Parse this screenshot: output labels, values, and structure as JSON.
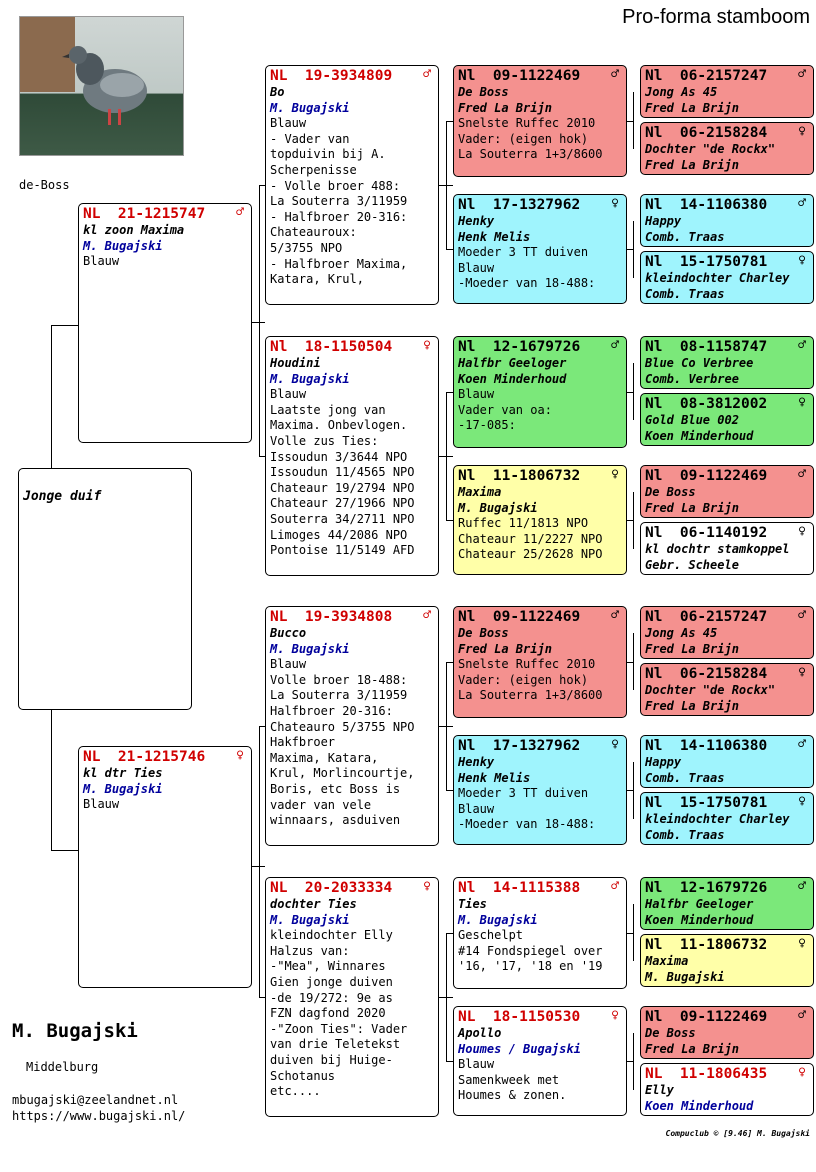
{
  "title": "Pro-forma stamboom",
  "photo_caption": "de-Boss",
  "young_bird_label": "Jonge duif",
  "owner": {
    "name": "M. Bugajski",
    "city": "Middelburg",
    "email": "mbugajski@zeelandnet.nl",
    "website": "https://www.bugajski.nl/"
  },
  "footer": "Compuclub © [9.46]  M. Bugajski",
  "sex_icons": {
    "male": "♂",
    "female": "♀"
  },
  "gen1": [
    {
      "ring": "NL  21-1215747",
      "sex": "♂",
      "name": "kl zoon Maxima",
      "owner": "M. Bugajski",
      "note": "Blauw"
    },
    {
      "ring": "NL  21-1215746",
      "sex": "♀",
      "name": "kl dtr Ties",
      "owner": "M. Bugajski",
      "note": "Blauw"
    }
  ],
  "gen2": [
    {
      "ring": "NL  19-3934809",
      "sex": "♂",
      "name": "Bo",
      "owner": "M. Bugajski",
      "note": "Blauw\n- Vader van\ntopduivin bij A.\nScherpenisse\n- Volle broer 488:\nLa Souterra  3/11959\n- Halfbroer 20-316:\nChateauroux:\n        5/3755 NPO\n- Halfbroer Maxima,\nKatara, Krul,"
    },
    {
      "ring": "Nl  18-1150504",
      "sex": "♀",
      "name": "Houdini",
      "owner": "M. Bugajski",
      "note": "Blauw\nLaatste jong van\nMaxima. Onbevlogen.\nVolle zus Ties:\nIssoudun 3/3644 NPO\nIssoudun 11/4565 NPO\nChateaur 19/2794 NPO\nChateaur 27/1966 NPO\nSouterra 34/2711 NPO\nLimoges 44/2086 NPO\nPontoise 11/5149 AFD"
    },
    {
      "ring": "NL  19-3934808",
      "sex": "♂",
      "name": "Bucco",
      "owner": "M. Bugajski",
      "note": "Blauw\nVolle broer 18-488:\nLa Souterra  3/11959\nHalfbroer 20-316:\nChateauro 5/3755 NPO\nHakfbroer\nMaxima, Katara,\nKrul, Morlincourtje,\nBoris, etc Boss is\nvader van vele\nwinnaars, asduiven"
    },
    {
      "ring": "NL  20-2033334",
      "sex": "♀",
      "name": "dochter Ties",
      "owner": "M. Bugajski",
      "note": "kleindochter Elly\nHalzus van:\n-\"Mea\", Winnares\nGien jonge duiven\n-de 19/272: 9e as\nFZN dagfond 2020\n-\"Zoon Ties\": Vader\nvan drie Teletekst\nduiven bij Huige-\nSchotanus\netc...."
    }
  ],
  "gen3": [
    {
      "ring": "Nl  09-1122469",
      "sex": "♂",
      "name": "De Boss",
      "owner": "Fred La Brijn",
      "note": "Snelste Ruffec 2010\nVader: (eigen hok)\nLa Souterra 1+3/8600",
      "color": "red"
    },
    {
      "ring": "Nl  17-1327962",
      "sex": "♀",
      "name": "Henky",
      "owner": "Henk Melis",
      "note": "Moeder 3 TT duiven\nBlauw\n-Moeder van 18-488:",
      "color": "cyan"
    },
    {
      "ring": "Nl  12-1679726",
      "sex": "♂",
      "name": "Halfbr Geeloger",
      "owner": "Koen Minderhoud",
      "note": "Blauw\nVader van oa:\n-17-085:",
      "color": "green"
    },
    {
      "ring": "Nl  11-1806732",
      "sex": "♀",
      "name": "Maxima",
      "owner": "M. Bugajski",
      "note": "Ruffec 11/1813 NPO\nChateaur 11/2227 NPO\nChateaur 25/2628 NPO",
      "color": "yellow"
    },
    {
      "ring": "Nl  09-1122469",
      "sex": "♂",
      "name": "De Boss",
      "owner": "Fred La Brijn",
      "note": "Snelste Ruffec 2010\nVader: (eigen hok)\nLa Souterra 1+3/8600",
      "color": "red"
    },
    {
      "ring": "Nl  17-1327962",
      "sex": "♀",
      "name": "Henky",
      "owner": "Henk Melis",
      "note": "Moeder 3 TT duiven\nBlauw\n-Moeder van 18-488:",
      "color": "cyan"
    },
    {
      "ring": "Nl  14-1115388",
      "sex": "♂",
      "name": "Ties",
      "owner": "M. Bugajski",
      "note": "Geschelpt\n#14 Fondspiegel over\n'16, '17, '18 en '19",
      "color": "white"
    },
    {
      "ring": "NL  18-1150530",
      "sex": "♀",
      "name": "Apollo",
      "owner": "Houmes / Bugajski",
      "note": "Blauw\nSamenkweek met\nHoumes & zonen.",
      "color": "white"
    }
  ],
  "gen4": [
    {
      "ring": "Nl  06-2157247",
      "sex": "♂",
      "name": "Jong As 45",
      "owner": "Fred La Brijn",
      "color": "red"
    },
    {
      "ring": "Nl  06-2158284",
      "sex": "♀",
      "name": "Dochter \"de Rockx\"",
      "owner": "Fred La Brijn",
      "color": "red"
    },
    {
      "ring": "Nl  14-1106380",
      "sex": "♂",
      "name": "Happy",
      "owner": "Comb. Traas",
      "color": "cyan"
    },
    {
      "ring": "Nl  15-1750781",
      "sex": "♀",
      "name": "kleindochter Charley",
      "owner": "Comb. Traas",
      "color": "cyan"
    },
    {
      "ring": "Nl  08-1158747",
      "sex": "♂",
      "name": "Blue Co Verbree",
      "owner": "Comb. Verbree",
      "color": "green"
    },
    {
      "ring": "Nl  08-3812002",
      "sex": "♀",
      "name": "Gold Blue 002",
      "owner": "Koen Minderhoud",
      "color": "green"
    },
    {
      "ring": "Nl  09-1122469",
      "sex": "♂",
      "name": "De Boss",
      "owner": "Fred La Brijn",
      "color": "red"
    },
    {
      "ring": "Nl  06-1140192",
      "sex": "♀",
      "name": "kl dochtr stamkoppel",
      "owner": "Gebr. Scheele",
      "color": "white"
    },
    {
      "ring": "Nl  06-2157247",
      "sex": "♂",
      "name": "Jong As 45",
      "owner": "Fred La Brijn",
      "color": "red"
    },
    {
      "ring": "Nl  06-2158284",
      "sex": "♀",
      "name": "Dochter \"de Rockx\"",
      "owner": "Fred La Brijn",
      "color": "red"
    },
    {
      "ring": "Nl  14-1106380",
      "sex": "♂",
      "name": "Happy",
      "owner": "Comb. Traas",
      "color": "cyan"
    },
    {
      "ring": "Nl  15-1750781",
      "sex": "♀",
      "name": "kleindochter Charley",
      "owner": "Comb. Traas",
      "color": "cyan"
    },
    {
      "ring": "Nl  12-1679726",
      "sex": "♂",
      "name": "Halfbr Geeloger",
      "owner": "Koen Minderhoud",
      "color": "green"
    },
    {
      "ring": "Nl  11-1806732",
      "sex": "♀",
      "name": "Maxima",
      "owner": "M. Bugajski",
      "color": "yellow"
    },
    {
      "ring": "Nl  09-1122469",
      "sex": "♂",
      "name": "De Boss",
      "owner": "Fred La Brijn",
      "color": "red"
    },
    {
      "ring": "NL  11-1806435",
      "sex": "♀",
      "name": "Elly",
      "owner": "Koen Minderhoud",
      "color": "white"
    }
  ]
}
